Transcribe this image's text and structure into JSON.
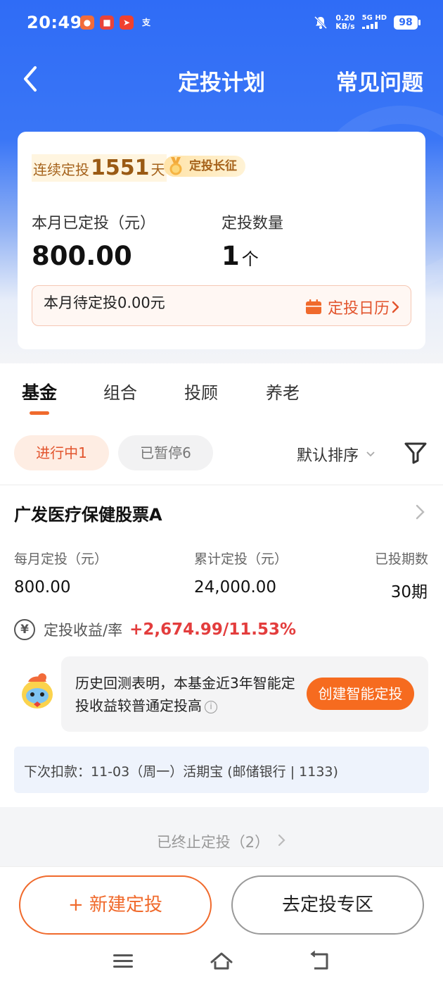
{
  "status_bar": {
    "time": "20:49",
    "net_speed_value": "0.20",
    "net_speed_unit": "KB/s",
    "signal": "5G HD",
    "battery": "98"
  },
  "navbar": {
    "title": "定投计划",
    "faq": "常见问题"
  },
  "summary": {
    "streak_prefix": "连续定投",
    "streak_days": "1551",
    "streak_suffix": "天",
    "badge": "定投长征",
    "month_invested_label": "本月已定投（元）",
    "month_invested_value": "800.00",
    "plan_count_label": "定投数量",
    "plan_count_value": "1",
    "plan_count_unit": "个",
    "pending_text": "本月待定投0.00元",
    "calendar_link": "定投日历"
  },
  "tabs": [
    "基金",
    "组合",
    "投顾",
    "养老"
  ],
  "filters": {
    "active_chip": "进行中1",
    "paused_chip": "已暂停6",
    "sort_label": "默认排序"
  },
  "fund": {
    "name": "广发医疗保健股票A",
    "columns": [
      {
        "label": "每月定投（元）",
        "value": "800.00"
      },
      {
        "label": "累计定投（元）",
        "value": "24,000.00"
      },
      {
        "label": "已投期数",
        "value": "30期"
      }
    ],
    "profit_symbol": "¥",
    "profit_label": "定投收益/率",
    "profit_value": "+2,674.99/11.53%",
    "tip_text": "历史回测表明，本基金近3年智能定投收益较普通定投高",
    "tip_button": "创建智能定投",
    "next_debit": "下次扣款：11-03（周一）活期宝 (邮储银行 | 1133)"
  },
  "terminated": "已终止定投（2）",
  "bottom": {
    "new_button": "+ 新建定投",
    "zone_button": "去定投专区"
  },
  "colors": {
    "brand_blue": "#2f6cf6",
    "accent_orange": "#f06a2c",
    "profit_red": "#e33d3d"
  }
}
